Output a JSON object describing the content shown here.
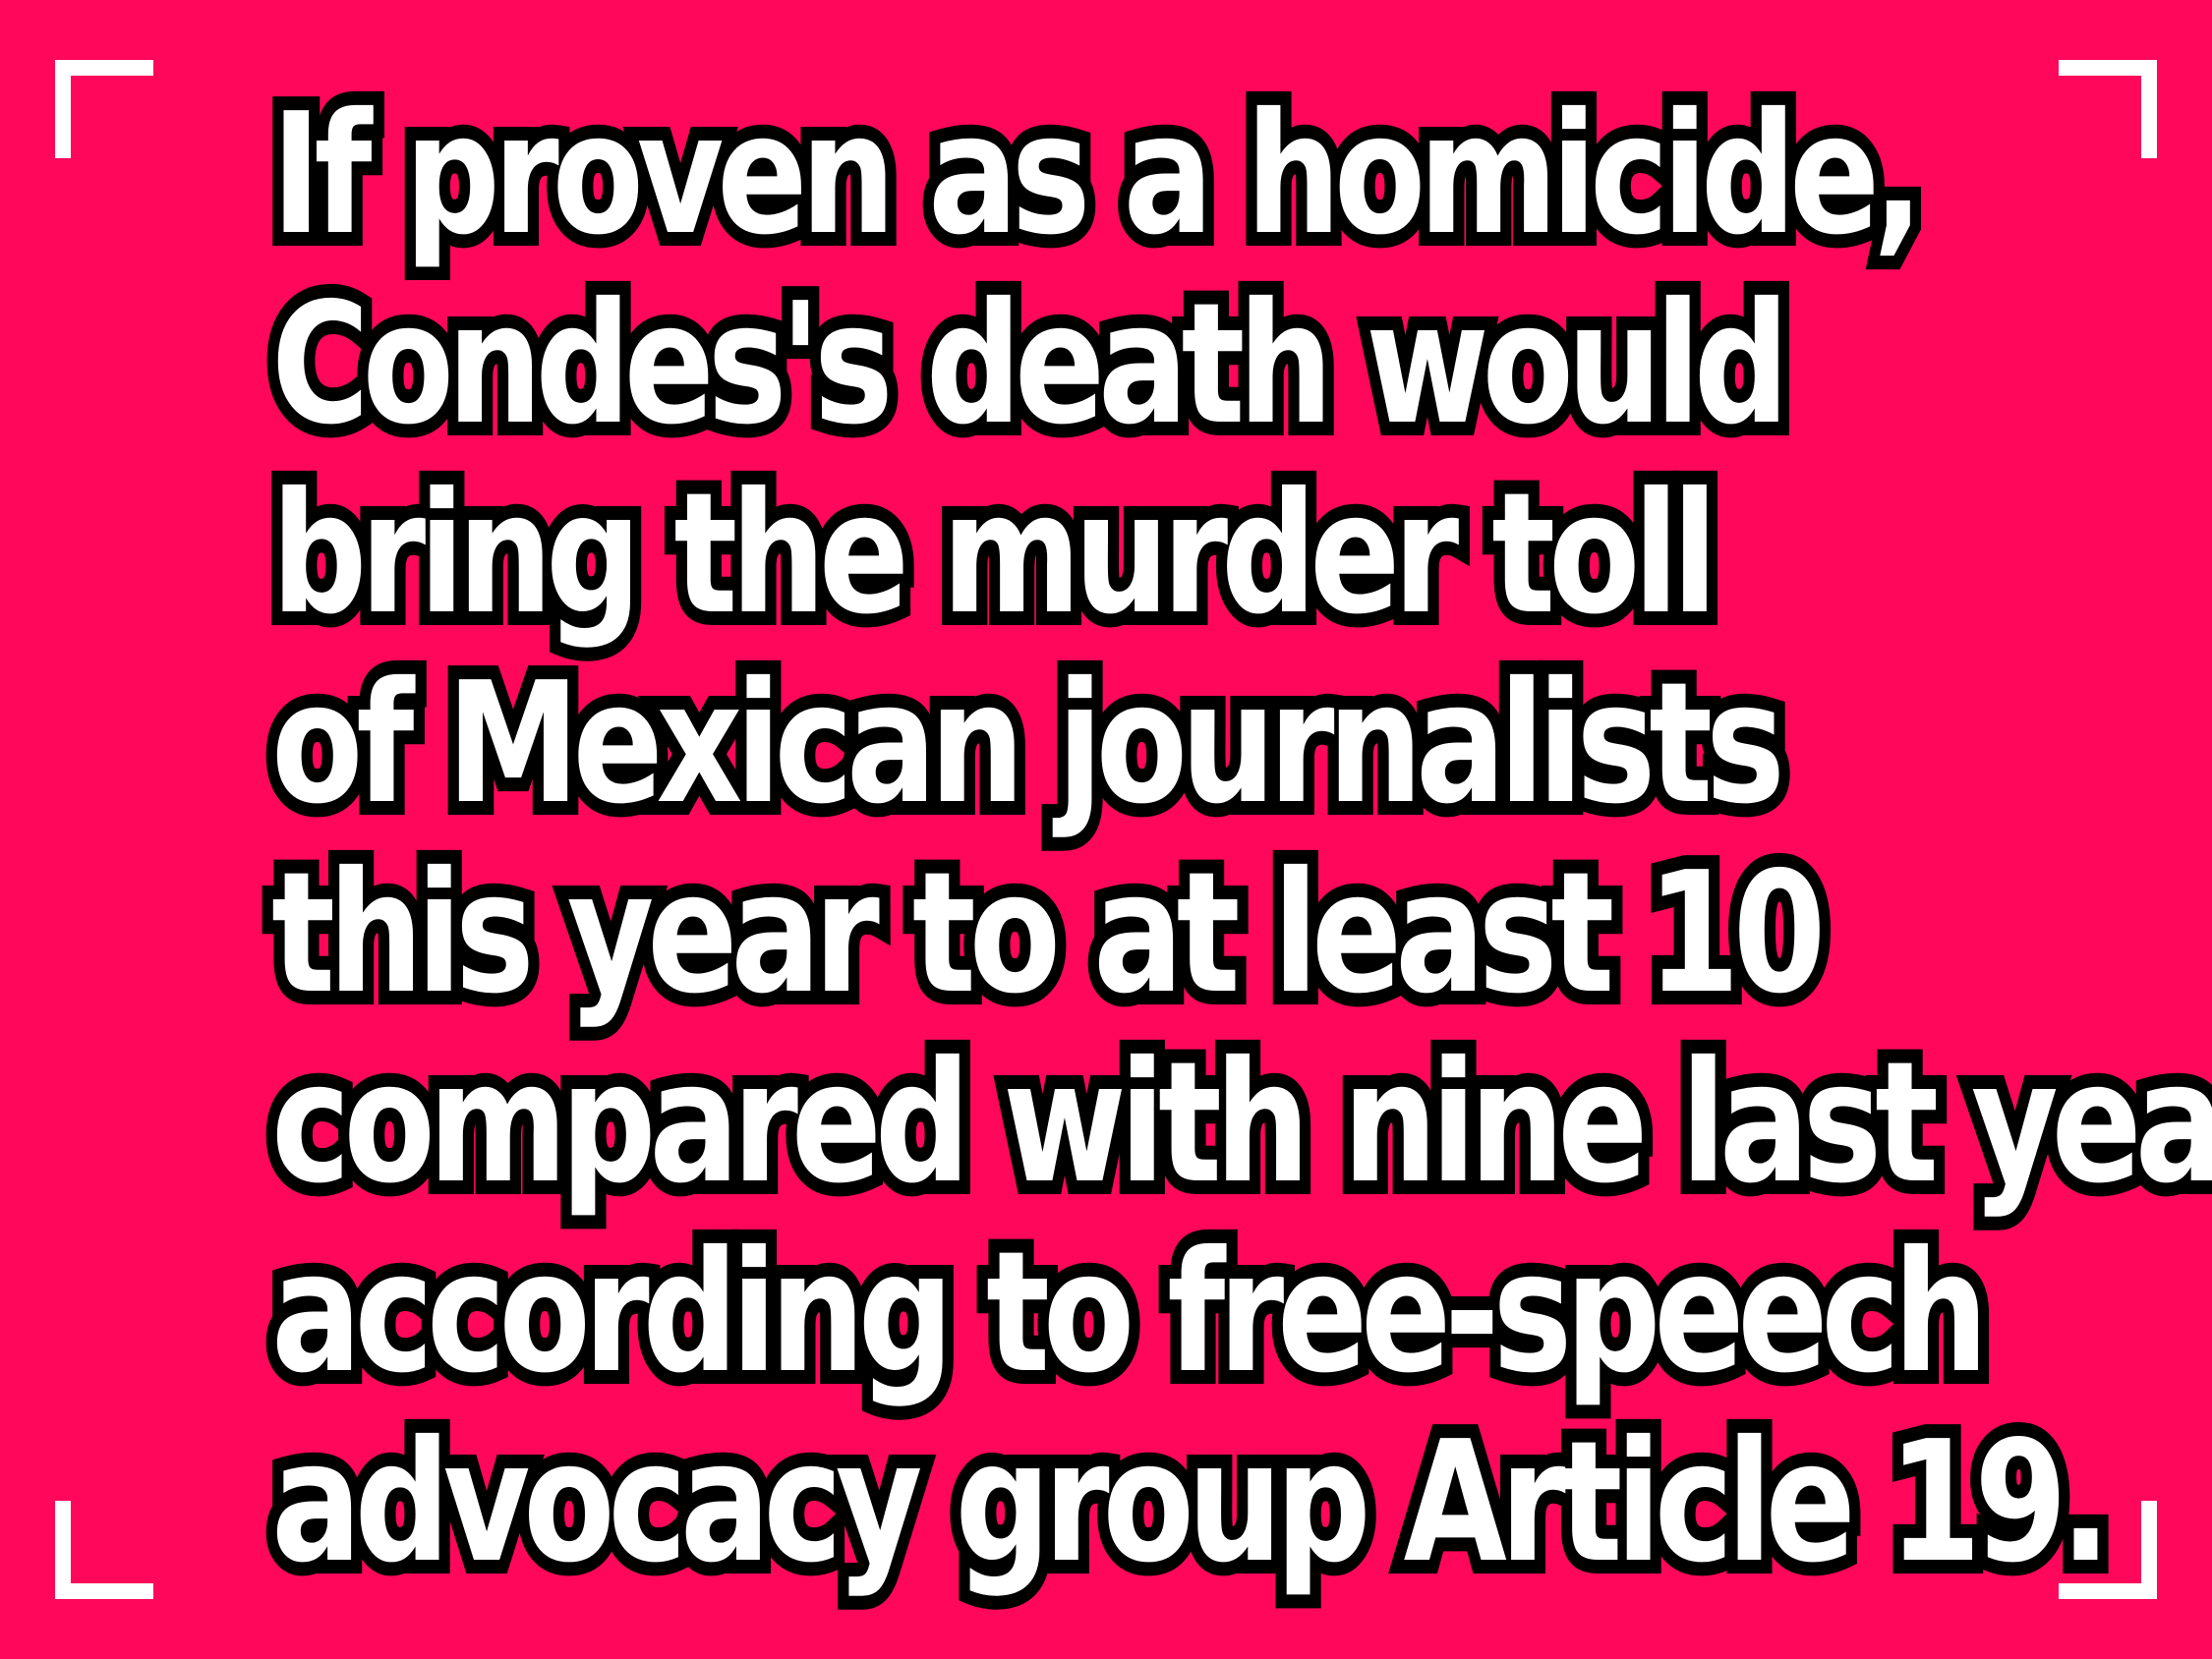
{
  "background_color": "#ff075a",
  "text_color": "#ffffff",
  "outline_color": "#000000",
  "frame": {
    "corner_icon": "corner-bracket-icon",
    "color": "#ffffff"
  },
  "quote": {
    "lines": [
      "If proven as a homicide,",
      "Condes's death would",
      "bring the murder toll",
      "of Mexican journalists",
      "this year to at least 10",
      "compared with nine last year,",
      "according to free-speech",
      "advocacy group Article 19."
    ]
  }
}
